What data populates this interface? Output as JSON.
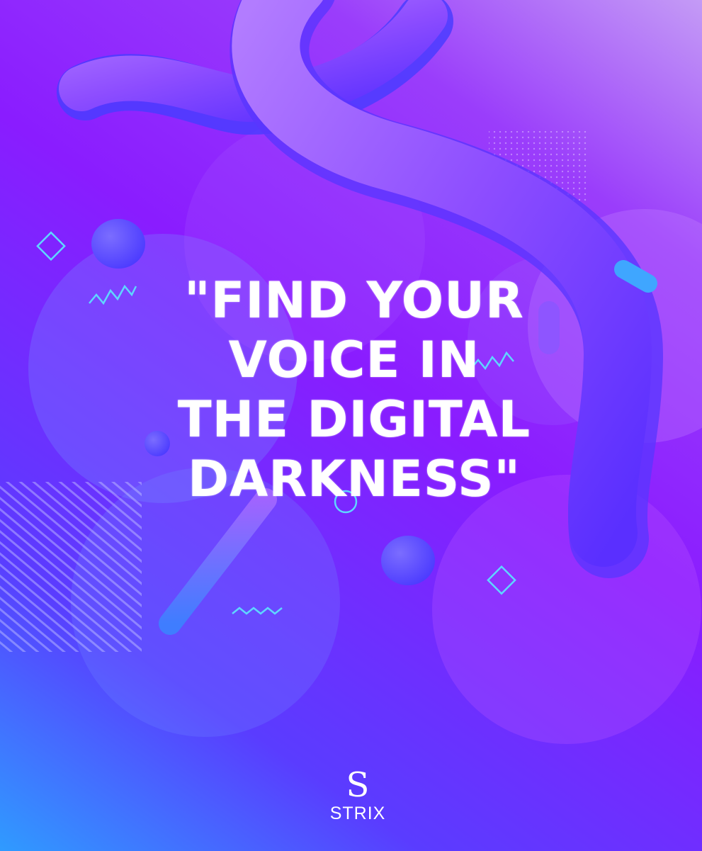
{
  "quote": {
    "lines": [
      "\"FIND YOUR",
      "VOICE IN",
      "THE DIGITAL",
      "DARKNESS\""
    ]
  },
  "logo": {
    "mark": "S",
    "wordmark": "STRIX"
  },
  "colors": {
    "accent": "#5fd6ff",
    "violet": "#8a1cff",
    "blue": "#2f9bff"
  }
}
